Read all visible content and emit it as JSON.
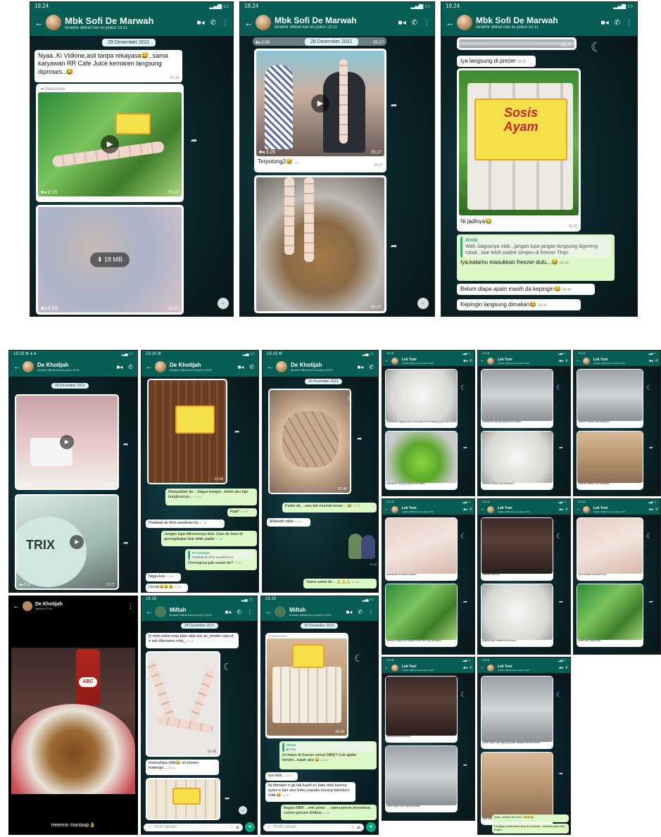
{
  "top": {
    "s1": {
      "status_time": "19.24",
      "status_right": "• • •",
      "name": "Mbk Sofi De Marwah",
      "sub": "terakhir dilihat hari ini pukul 19.11",
      "date": "29 Desember 2021",
      "msg1": "Nyaa..Ki Vidione,asli tanpa rekayasa😅..sama karyawan RR Cafe Juice kemaren langsung diproses..😂",
      "msg1_time": "05.26",
      "forwarded": "Diteruskan",
      "video1_len": "0.15",
      "video1_time": "05.27",
      "download": "18 MB",
      "video2_len": "3.59",
      "video2_time": "05.27"
    },
    "s2": {
      "status_time": "19.24",
      "name": "Mbk Sofi De Marwah",
      "sub": "terakhir dilihat hari ini pukul 19.11",
      "date": "29 Desember 2021",
      "vid_top_len": "3.56",
      "vid_top_time": "05.27",
      "video_len": "3.20",
      "video_time": "05.27",
      "caption": "Terpotong2😅 ...",
      "caption_time": "05.27",
      "pot_time": "05.27"
    },
    "s3": {
      "status_time": "19.24",
      "name": "Mbk Sofi De Marwah",
      "sub": "terakhir dilihat hari ini pukul 19.11",
      "top_time": "05.27",
      "msg1": "Iya langsung di prezer",
      "msg1_time": "05.32",
      "pack_line1": "Sosis",
      "pack_line2": "Ayam",
      "caption": "Ni jadinya😂",
      "caption_time": "05.35",
      "quote_name": "Anda",
      "quote_text": "Wah..bagusnya mbk...jangan lupa jangan langsung digoreng mbak...biar lebih padett simpen di freezer Thqri",
      "reply": "Iya,katamu masukkan freezer dulu...😂",
      "reply_time": "05.39",
      "msg2": "Belum diapa apain masih da kepingin😂",
      "msg2_time": "05.40",
      "msg3": "Kepingin langsung dimakan😂",
      "msg3_time": "05.40"
    }
  },
  "bottom_left": {
    "k1": {
      "name": "De Khotijah",
      "sub": "terakhir dilihat hari ini pukul 19.09",
      "date": "29 Desember 2021",
      "v1_len": "0.14",
      "v1_time": "13.27",
      "brand": "TRIX",
      "v2_len": "0.12",
      "v2_time": "13.27"
    },
    "k2": {
      "name": "De Khotijah",
      "sub": "terakhir dilihat hari ini pukul 19.09",
      "img_time": "13.58",
      "m1": "Masyaallah de....bagus banget ..kalah aku tapi bungkusnya....",
      "m1_time": "17.37",
      "m2": "Rapi*",
      "m2_time": "17.38",
      "m3": "Padahal de khot sendirian ku",
      "m3_time": "17.38",
      "m4": "Jangan lupa difreezenya dulu 1han de baru di goreng/bakar biar lebih padet",
      "m4_time": "17.40",
      "q_name": "De Khotijah",
      "q_text": "Padahal de khot sendirian ku",
      "m5": "Dorongnya gak susah de?",
      "m5_time": "17.40",
      "m6": "Ngga kok",
      "m6_time": "17.45",
      "m7": "Lincar😀😀😀",
      "m7_time": "17.54"
    },
    "k3": {
      "name": "De Khotijah",
      "sub": "terakhir dilihat hari ini pukul 19.09",
      "date": "30 Desember 2021",
      "img_time": "07.40",
      "m1": "Padet de....wes lah mantab tenan .. 😂",
      "m1_time": "10.15",
      "m2": "Makasih nduk",
      "m2_time": "10.15",
      "sticker_time": "10.16",
      "m3": "Sama sama de... 🙏🙏🙏",
      "m3_time": "10.51"
    },
    "story": {
      "name": "De Khotijah",
      "sub": "Hari ini 07.38",
      "bottle": "ABC",
      "caption": "Heemm mantaap👌"
    },
    "m1": {
      "name": "Miftah",
      "sub": "terakhir dilihat hari ini pukul 19.09",
      "date": "29 Desember 2021",
      "msg": "Iy mbk,eslne mau kate sdta wiz an_tender capcul e sek dberaimo mbk_",
      "msg_time": "13.26",
      "img_time": "10.48",
      "caption": "mamuthiya mbk😂 sn proses matengo...",
      "caption_time": "16.28",
      "input": "Kirim pesan"
    },
    "m2": {
      "name": "Miftah",
      "sub": "terakhir dilihat hari ini pukul 19.09",
      "date": "30 Desember 2021",
      "forwarded": "Diteruskan",
      "img_time": "06.38",
      "q_name": "Miftah",
      "q_text": "■ Foto",
      "m1": "Ini hatos di freezer sehari MBK? Cek aplike betuke...kalah aku 😂",
      "m1_time": "10.58",
      "m2": "Iya mbk..",
      "m2_time": "11.22",
      "m3": "Iki blenderi e gk tak kasih es batu mbk,karena ayam e kan wez beku,,kayaku kurang tepioka’e mbk 😂",
      "m3_time": "11.22",
      "m4": "Bagus MBK ...nek jemur ... sama persis prosedure.. cuman jamure dinibus",
      "m4_time": "11.29",
      "input": "Kirim pesan"
    }
  },
  "bottom_right": {
    "name": "Lek Yuni",
    "sub": "terakhir dilihat hari ini pukul 19.09",
    "y1_cap": "Masukkan dagiing dan bumbunya serta bawang putih dan fhonftina potong gula dan kodir ulangan bagian",
    "y2_cap": "Masukkan tepung tapioka ke dalam",
    "y3_cap": "Setelah masuk dan dicampur",
    "y4_cap": "Masukkan ke dalam plastik",
    "y5_cap": "Setelah masuk dim plastik sosis dan digi tali kasur",
    "y6_cap": "Setelah direbus",
    "y7_cap": "Angkat dan rendam air es dulu",
    "y8_cap": "Lalu simpan di lokasi frize",
    "y9_cap": "Sosis siap digoreng2",
    "y10_cap": "Hasilnya murai murai2",
    "y11_cap": "Sosis ayam siap digoreng atau",
    "y12_cap": "Sosis ayam siap digoreng atau dibakar sesuai selera",
    "y13_cap": "Atau dipanaskan",
    "y13_msg": "Wow...bestini lek Yuni.. 😂😂😂",
    "y13_msg2": "Lengkap pembuntas step by stepnya...nisawaa giimi lek? Enak?"
  }
}
